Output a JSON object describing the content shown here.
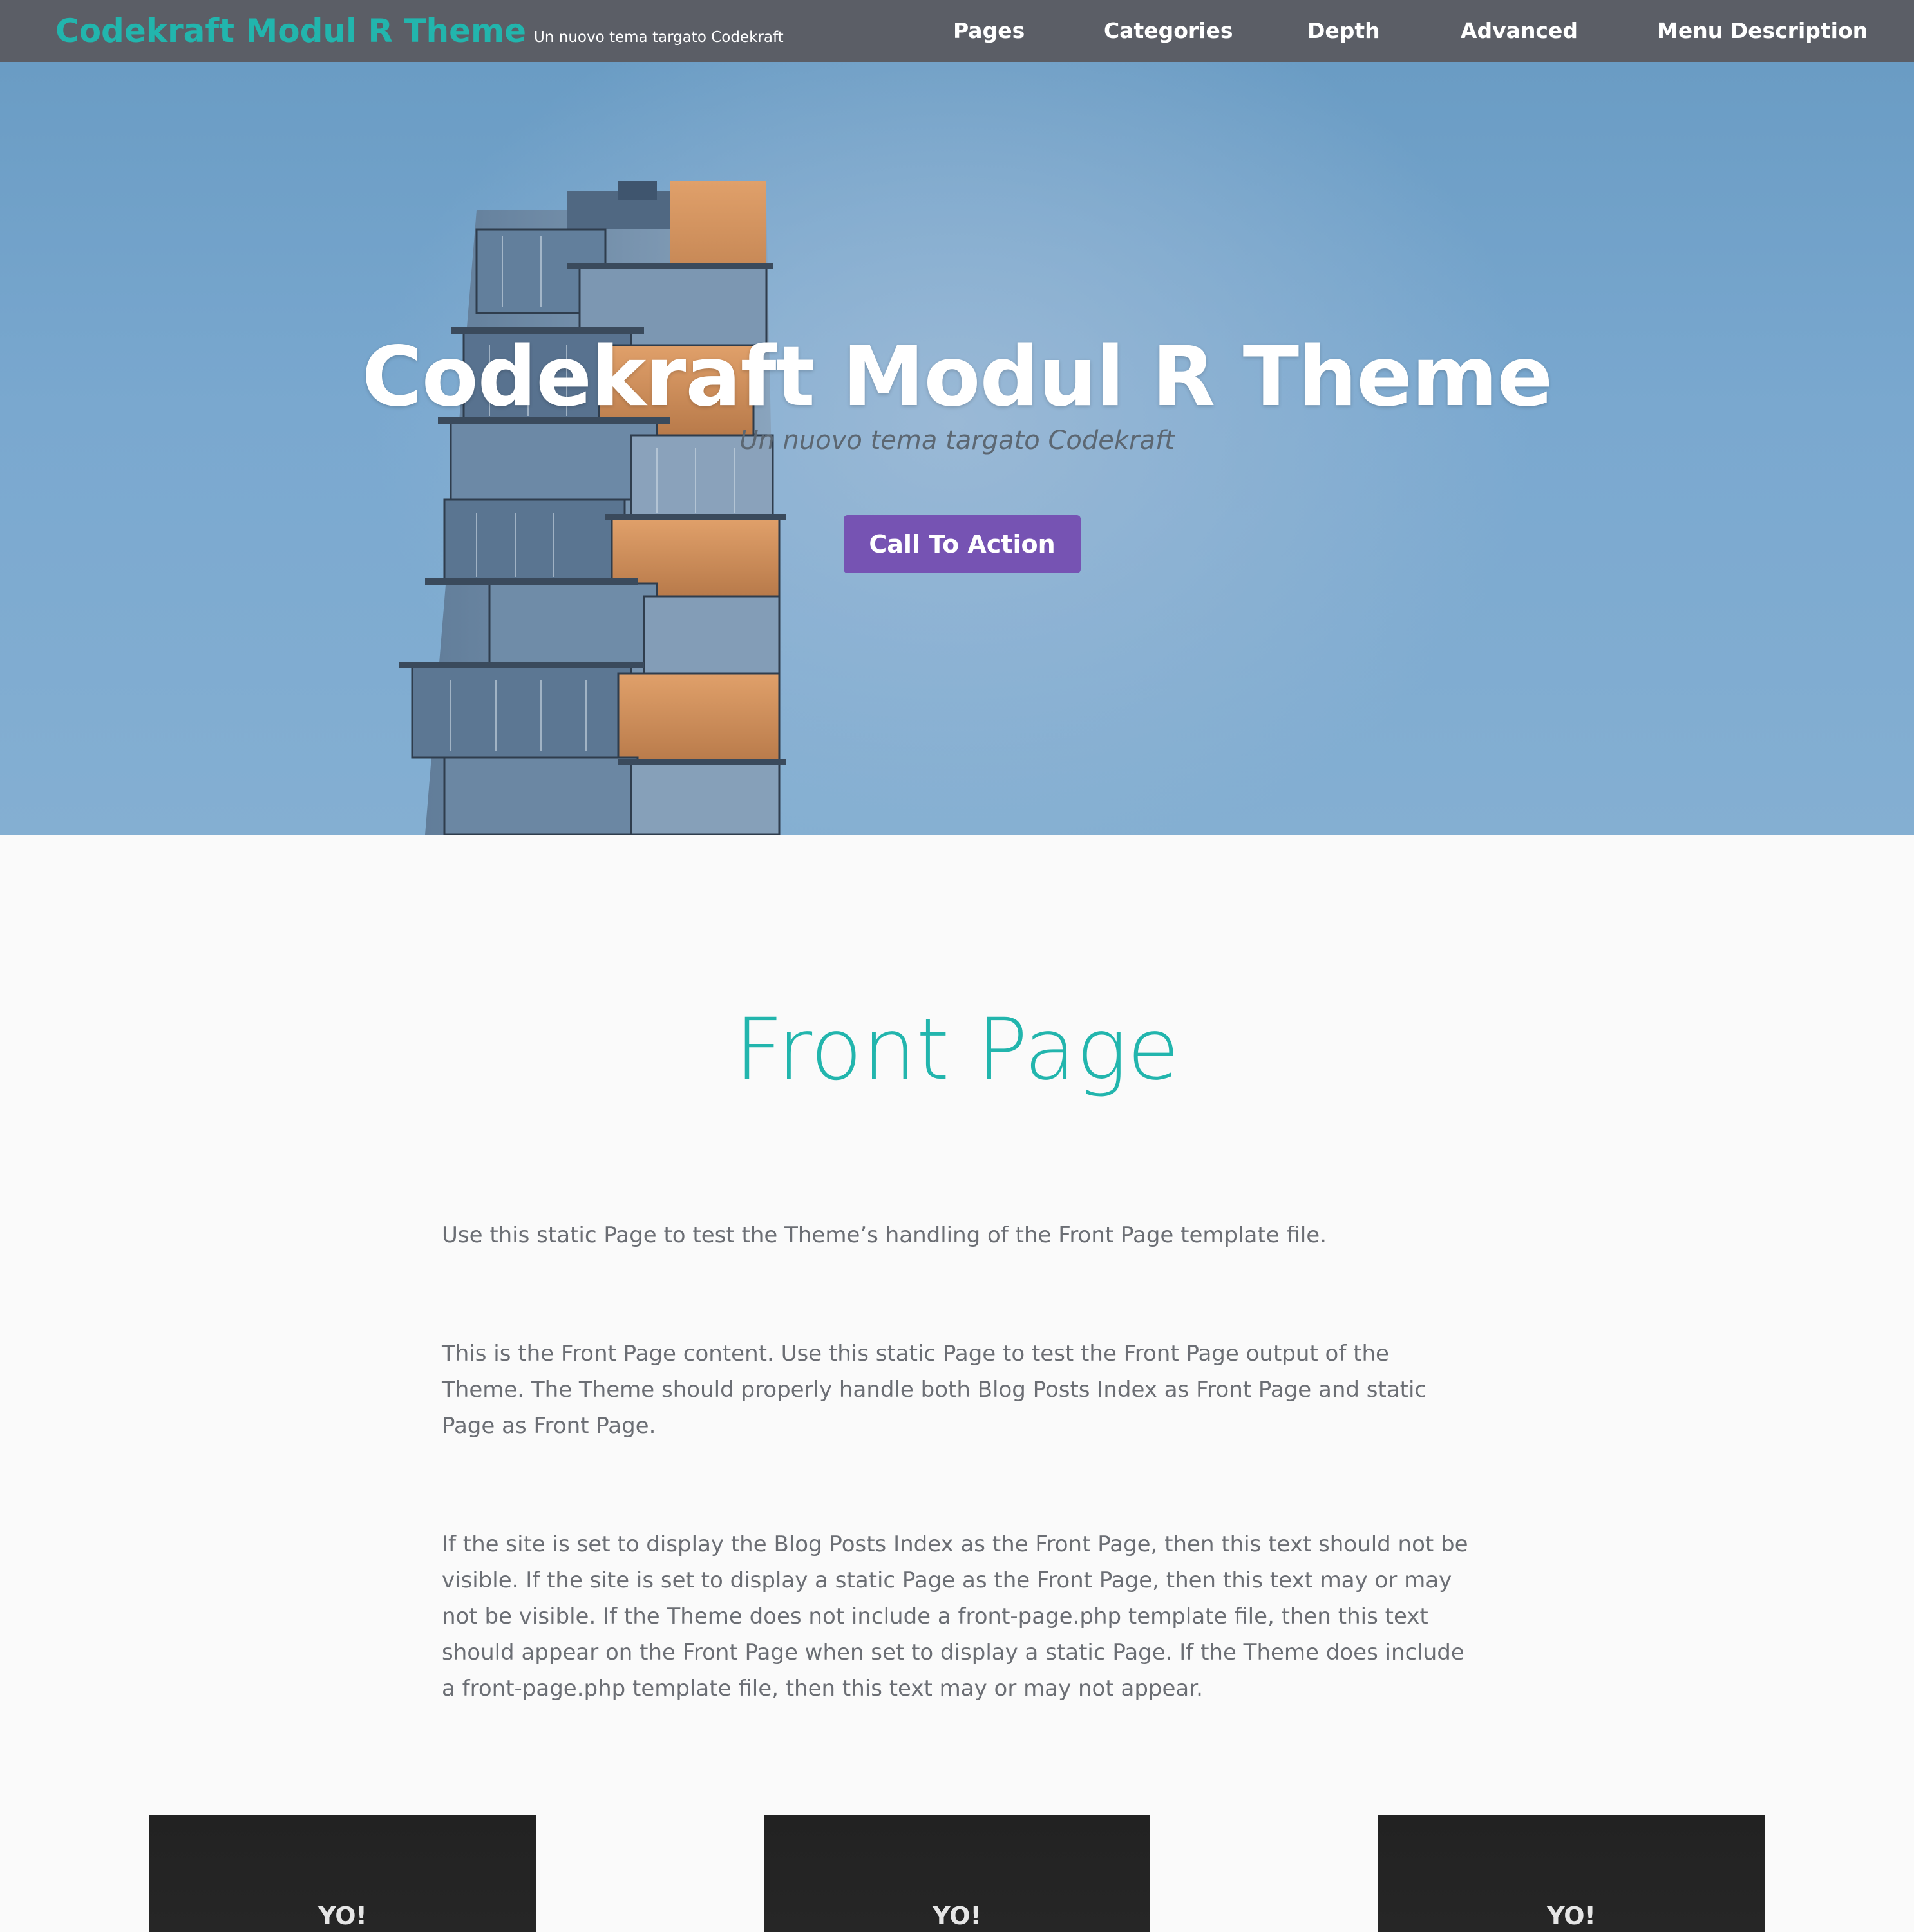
{
  "header": {
    "site_title": "Codekraft Modul R Theme",
    "tagline": "Un nuovo tema targato Codekraft",
    "nav": [
      {
        "label": "Pages"
      },
      {
        "label": "Categories"
      },
      {
        "label": "Depth"
      },
      {
        "label": "Advanced"
      },
      {
        "label": "Menu Description"
      }
    ]
  },
  "hero": {
    "title": "Codekraft Modul R Theme",
    "subtitle": "Un nuovo tema targato Codekraft",
    "cta_label": "Call To Action"
  },
  "main": {
    "page_title": "Front Page",
    "paragraphs": [
      "Use this static Page to test the Theme’s handling of the Front Page template file.",
      "This is the Front Page content. Use this static Page to test the Front Page output of the Theme. The Theme should properly handle both Blog Posts Index as Front Page and static Page as Front Page.",
      "If the site is set to display the Blog Posts Index as the Front Page, then this text should not be visible. If the site is set to display a static Page as the Front Page, then this text may or may not be visible. If the Theme does not include a front-page.php template file, then this text should appear on the Front Page when set to display a static Page. If the Theme does include a front-page.php template file, then this text may or may not appear."
    ]
  },
  "cards": [
    {
      "label": "YO!"
    },
    {
      "label": "YO!"
    },
    {
      "label": "YO!"
    }
  ],
  "colors": {
    "header_bg": "#5b5e66",
    "brand_accent": "#22b5ad",
    "cta_bg": "#7653b3",
    "card_bg": "#222222"
  }
}
